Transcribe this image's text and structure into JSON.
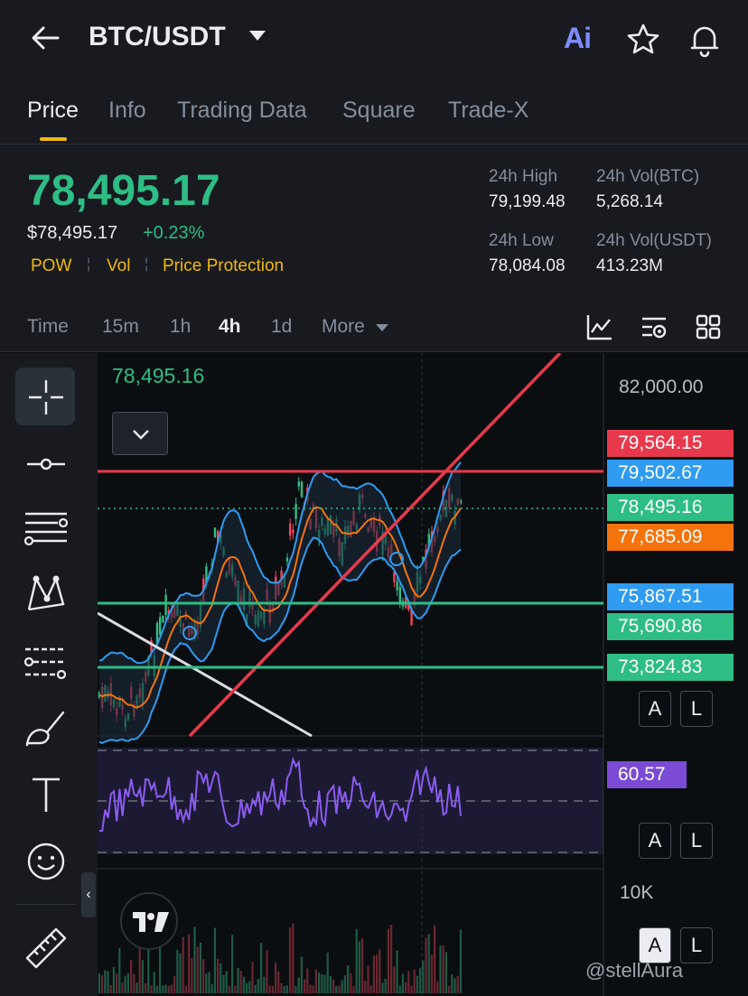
{
  "header": {
    "pair": "BTC/USDT",
    "ai_label": "Ai"
  },
  "tabs": [
    "Price",
    "Info",
    "Trading Data",
    "Square",
    "Trade-X"
  ],
  "price": {
    "last": "78,495.17",
    "usd": "$78,495.17",
    "change": "+0.23%",
    "tags": [
      "POW",
      "Vol",
      "Price Protection"
    ],
    "high_label": "24h High",
    "high": "79,199.48",
    "vol_btc_label": "24h Vol(BTC)",
    "vol_btc": "5,268.14",
    "low_label": "24h Low",
    "low": "78,084.08",
    "vol_usdt_label": "24h Vol(USDT)",
    "vol_usdt": "413.23M"
  },
  "intervals": {
    "items": [
      "Time",
      "15m",
      "1h",
      "4h",
      "1d",
      "More"
    ],
    "active": "4h"
  },
  "chart": {
    "current_price_label": "78,495.16",
    "axis_top": "82,000.00",
    "labels": [
      {
        "text": "79,564.15",
        "color": "#e8394c"
      },
      {
        "text": "79,502.67",
        "color": "#2f9bf1"
      },
      {
        "text": "78,495.16",
        "color": "#2ebd85"
      },
      {
        "text": "77,685.09",
        "color": "#f5730c"
      },
      {
        "text": "75,867.51",
        "color": "#2f9bf1"
      },
      {
        "text": "75,690.86",
        "color": "#2ebd85"
      },
      {
        "text": "73,824.83",
        "color": "#2ebd85"
      }
    ],
    "rsi_label": "60.57",
    "rsi_color": "#7b4bd6",
    "vol_axis": "10K",
    "al_buttons": [
      "A",
      "L"
    ]
  },
  "watermark": "@stellAura",
  "colors": {
    "up": "#2ebd85",
    "down": "#f6465d",
    "accent": "#f0b90b"
  },
  "icons": [
    "back-arrow-icon",
    "star-icon",
    "bell-icon",
    "indicator-icon",
    "chart-settings-icon",
    "grid-layout-icon",
    "crosshair-icon",
    "horizontal-line-icon",
    "fib-lines-icon",
    "pattern-icon",
    "parallel-lines-icon",
    "brush-icon",
    "text-icon",
    "emoji-icon",
    "ruler-icon",
    "tradingview-logo-icon"
  ]
}
